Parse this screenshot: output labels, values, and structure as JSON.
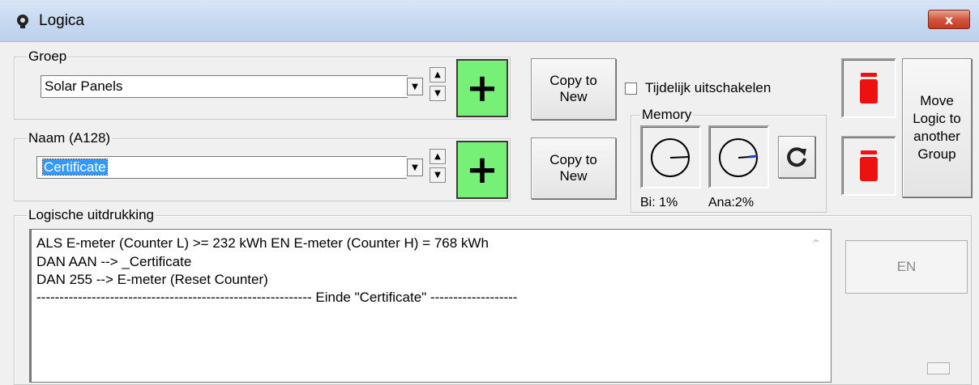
{
  "window": {
    "title": "Logica",
    "close_glyph": "x",
    "icon": "lightbulb-icon"
  },
  "groep": {
    "label": "Groep",
    "value": "Solar Panels"
  },
  "naam": {
    "label": "Naam (A128)",
    "value": "Certificate"
  },
  "buttons": {
    "copy_to_new": "Copy to\nNew",
    "move_logic": "Move\nLogic to\nanother\nGroup",
    "en": "EN",
    "plus": "+"
  },
  "options": {
    "tijdelijk_label": "Tijdelijk uitschakelen",
    "tijdelijk_checked": false
  },
  "memory": {
    "label": "Memory",
    "bi_label": "Bi: 1%",
    "ana_label": "Ana:2%",
    "bi_percent": 1,
    "ana_percent": 2
  },
  "logic": {
    "label": "Logische uitdrukking",
    "lines": [
      "ALS E-meter (Counter L) >= 232 kWh EN E-meter (Counter H) = 768 kWh",
      "DAN AAN --> _Certificate",
      "DAN 255 --> E-meter (Reset Counter)",
      "------------------------------------------------------------ Einde \"Certificate\" -------------------"
    ]
  },
  "colors": {
    "plus_green": "#77f077",
    "trash_red": "#ee1111",
    "selection_blue": "#3399ff",
    "close_red": "#c23b22"
  }
}
